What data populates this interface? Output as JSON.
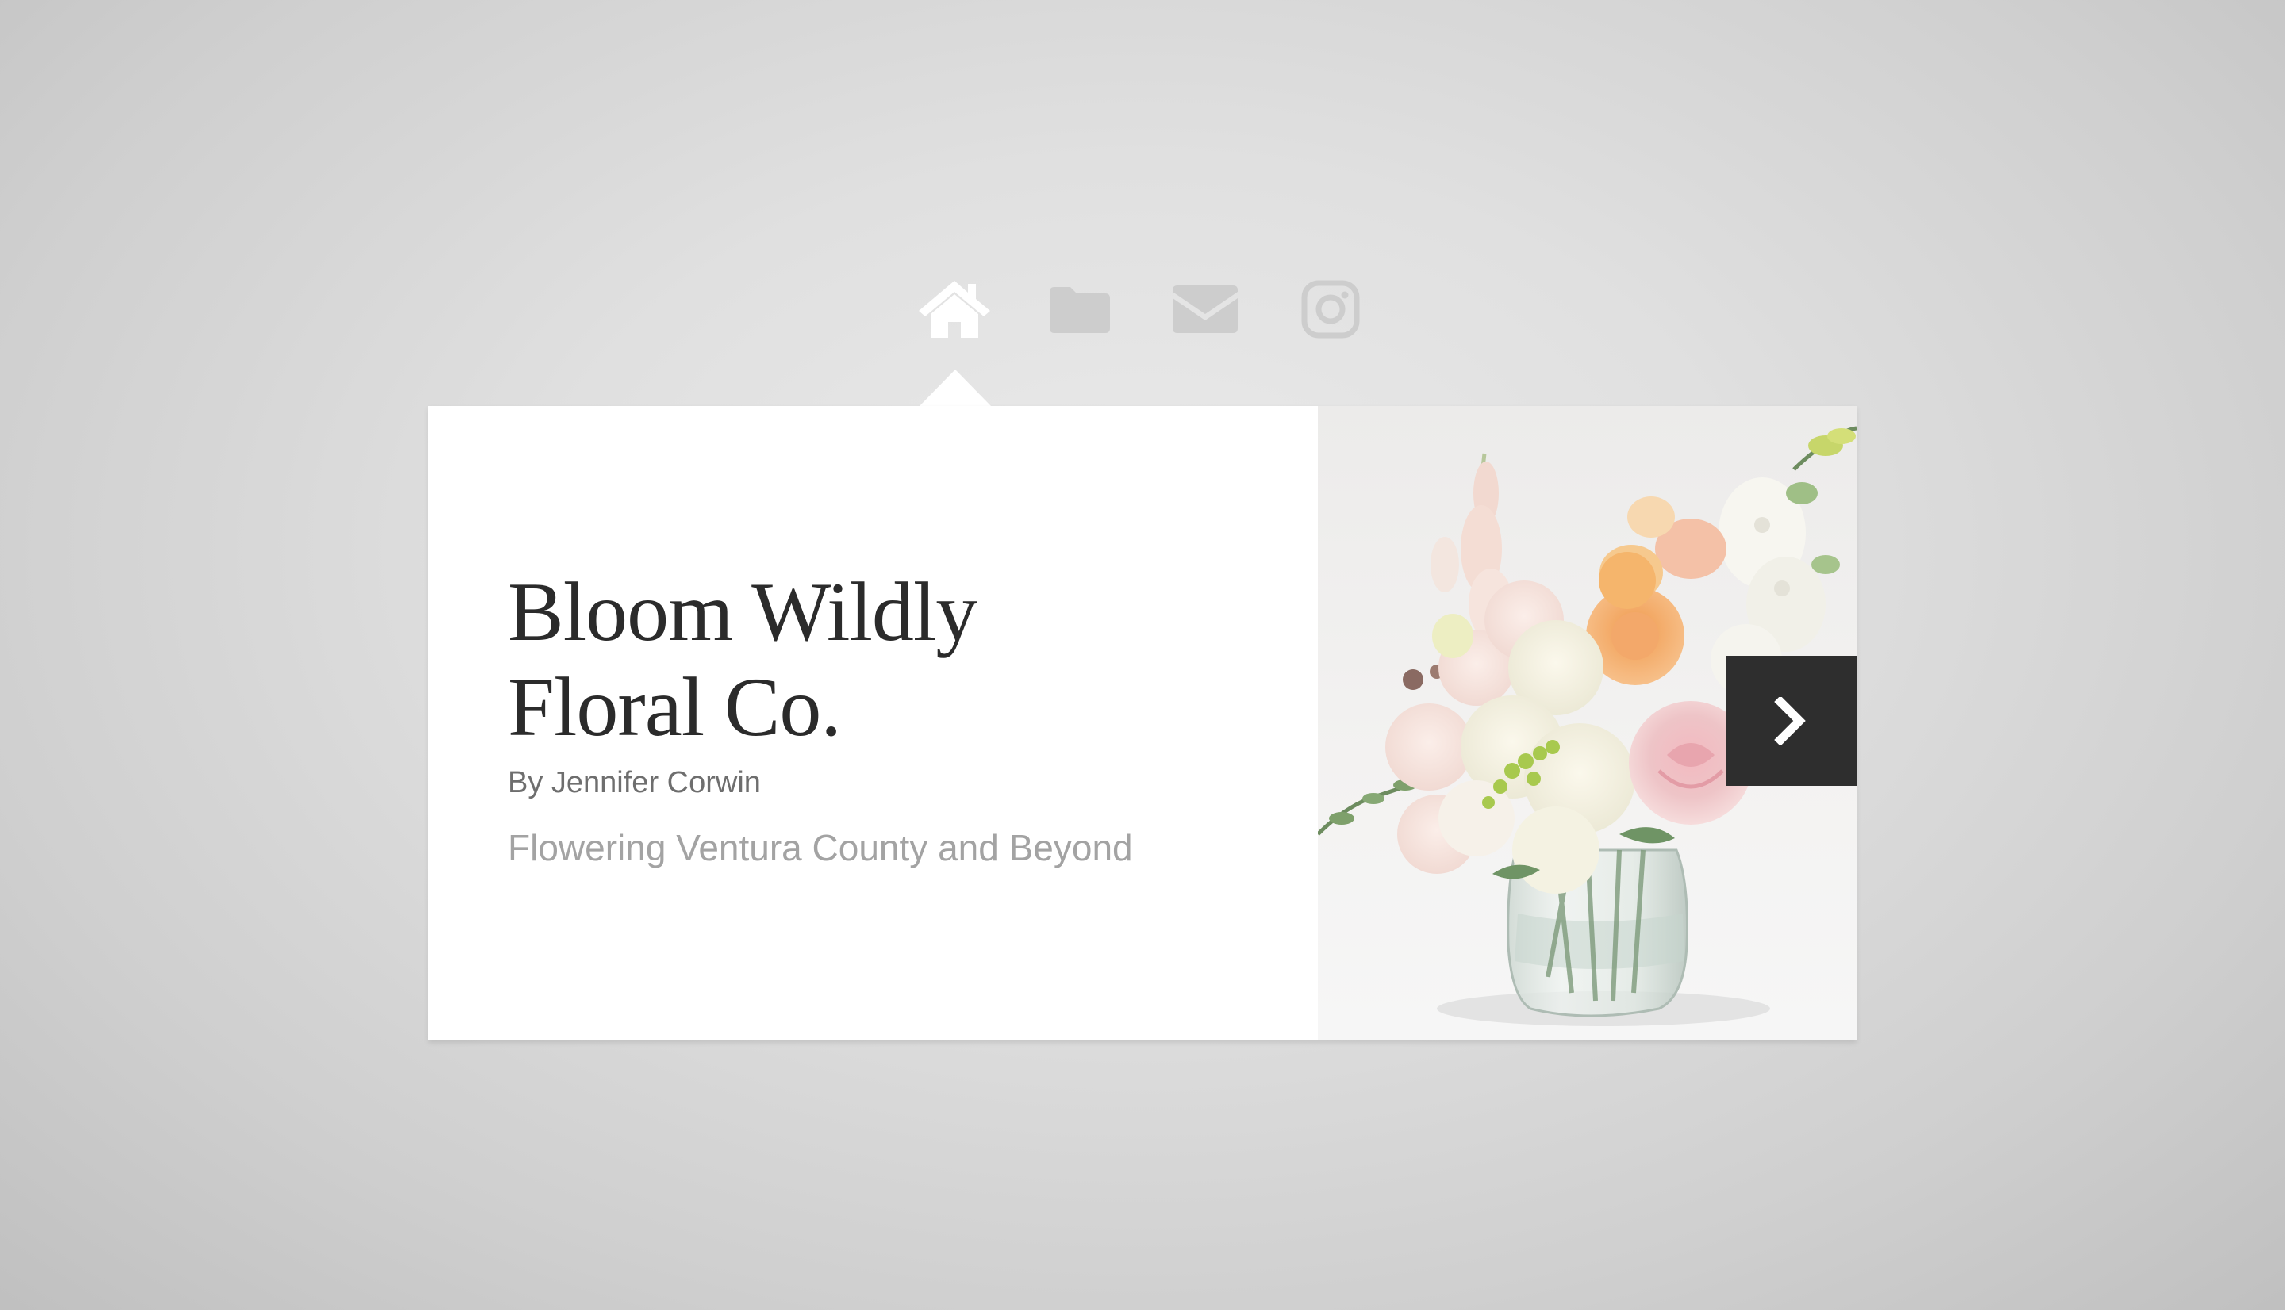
{
  "nav": {
    "items": [
      {
        "id": "home",
        "icon": "home-icon",
        "active": true
      },
      {
        "id": "portfolio",
        "icon": "folder-icon",
        "active": false
      },
      {
        "id": "contact",
        "icon": "mail-icon",
        "active": false
      },
      {
        "id": "instagram",
        "icon": "instagram-icon",
        "active": false
      }
    ],
    "active_color": "#ffffff",
    "inactive_color": "#cdcdcd"
  },
  "card": {
    "title_line1": "Bloom Wildly",
    "title_line2": "Floral Co.",
    "byline": "By Jennifer Corwin",
    "tagline": "Flowering Ventura County and Beyond",
    "image": {
      "subject": "flower-arrangement-in-glass-vase"
    },
    "next_icon": "chevron-right-icon"
  },
  "colors": {
    "title": "#2b2b2b",
    "byline": "#6e6e6e",
    "tagline": "#a3a3a3",
    "next_button_bg": "#2e2e2e"
  }
}
